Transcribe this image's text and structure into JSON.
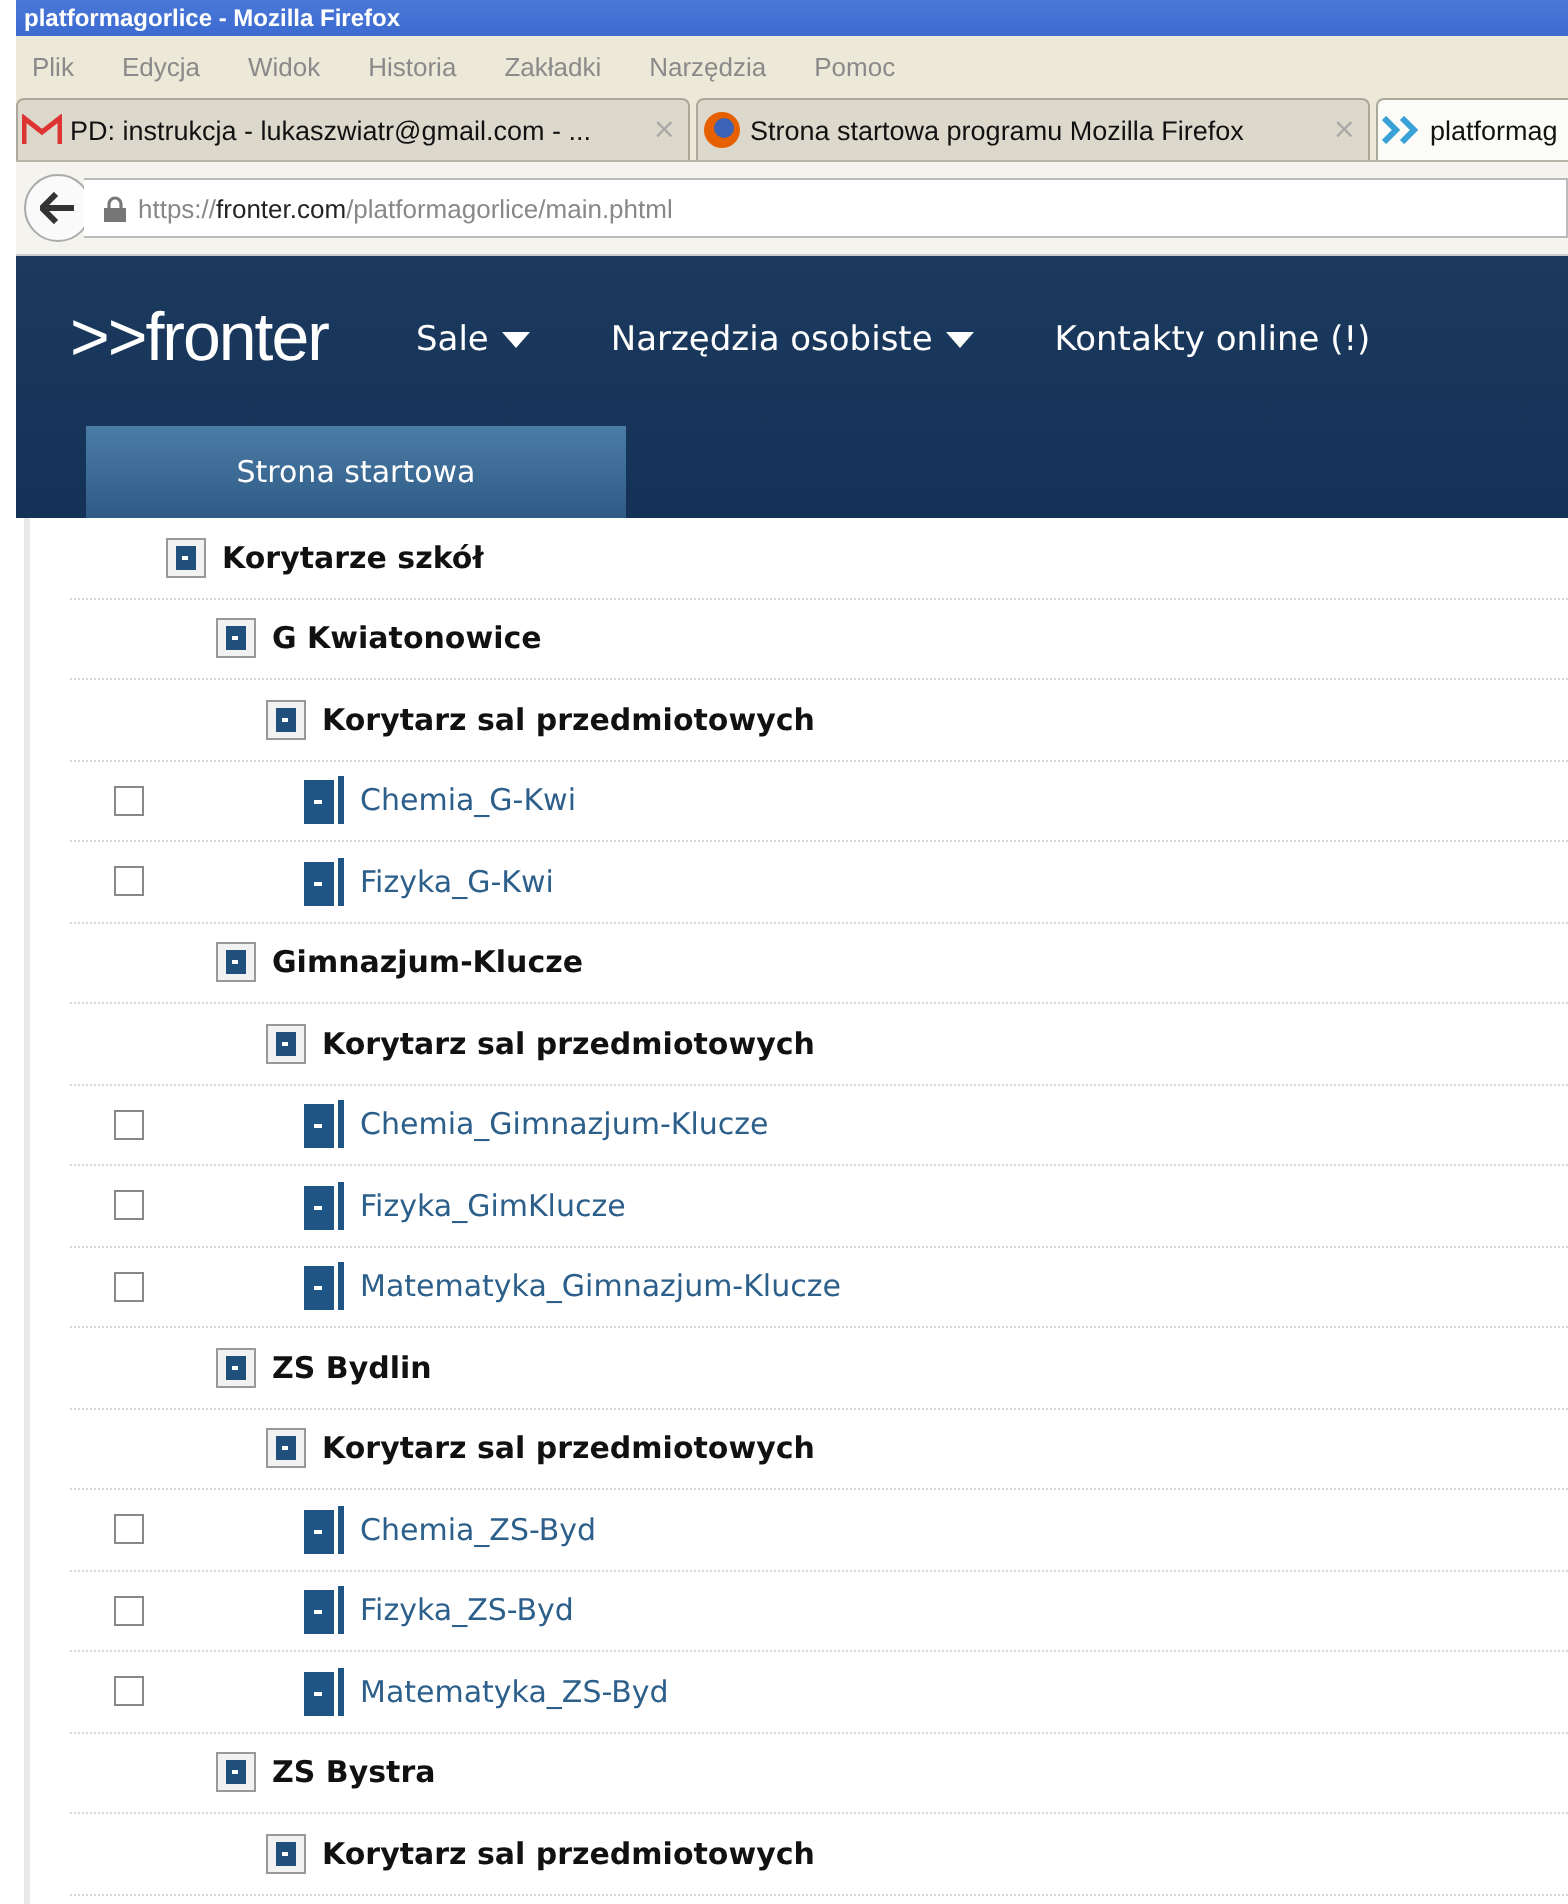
{
  "window": {
    "title": "platformagorlice - Mozilla Firefox"
  },
  "menu": [
    "Plik",
    "Edycja",
    "Widok",
    "Historia",
    "Zakładki",
    "Narzędzia",
    "Pomoc"
  ],
  "tabs": [
    {
      "kind": "mail",
      "label": "PD: instrukcja - lukaszwiatr@gmail.com - ...",
      "selected": false,
      "close": "×"
    },
    {
      "kind": "firefox",
      "label": "Strona startowa programu Mozilla Firefox",
      "selected": false,
      "close": "×"
    },
    {
      "kind": "fronter",
      "label": "platformag",
      "selected": true
    }
  ],
  "address": {
    "scheme": "https://",
    "host": "fronter.com",
    "path": "/platformagorlice/main.phtml"
  },
  "header": {
    "logo": ">>fronter",
    "nav": [
      {
        "label": "Sale",
        "dropdown": true
      },
      {
        "label": "Narzędzia osobiste",
        "dropdown": true
      },
      {
        "label": "Kontakty online (!)",
        "dropdown": false
      }
    ],
    "tabs": [
      {
        "label": "Strona startowa",
        "selected": true
      }
    ]
  },
  "tree": [
    {
      "kind": "folder",
      "label": "Korytarze szkół",
      "children": [
        {
          "kind": "folder",
          "label": "G Kwiatonowice",
          "children": [
            {
              "kind": "folder",
              "label": "Korytarz sal przedmiotowych",
              "children": [
                {
                  "kind": "room",
                  "label": "Chemia_G-Kwi",
                  "checked": false
                },
                {
                  "kind": "room",
                  "label": "Fizyka_G-Kwi",
                  "checked": false
                }
              ]
            }
          ]
        },
        {
          "kind": "folder",
          "label": "Gimnazjum-Klucze",
          "children": [
            {
              "kind": "folder",
              "label": "Korytarz sal przedmiotowych",
              "children": [
                {
                  "kind": "room",
                  "label": "Chemia_Gimnazjum-Klucze",
                  "checked": false
                },
                {
                  "kind": "room",
                  "label": "Fizyka_GimKlucze",
                  "checked": false
                },
                {
                  "kind": "room",
                  "label": "Matematyka_Gimnazjum-Klucze",
                  "checked": false
                }
              ]
            }
          ]
        },
        {
          "kind": "folder",
          "label": "ZS Bydlin",
          "children": [
            {
              "kind": "folder",
              "label": "Korytarz sal przedmiotowych",
              "children": [
                {
                  "kind": "room",
                  "label": "Chemia_ZS-Byd",
                  "checked": false
                },
                {
                  "kind": "room",
                  "label": "Fizyka_ZS-Byd",
                  "checked": false
                },
                {
                  "kind": "room",
                  "label": "Matematyka_ZS-Byd",
                  "checked": false
                }
              ]
            }
          ]
        },
        {
          "kind": "folder",
          "label": "ZS Bystra",
          "children": [
            {
              "kind": "folder",
              "label": "Korytarz sal przedmiotowych"
            }
          ]
        }
      ]
    }
  ]
}
